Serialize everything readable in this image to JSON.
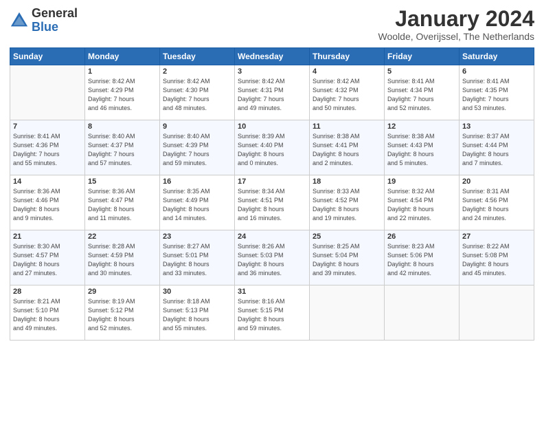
{
  "header": {
    "logo_general": "General",
    "logo_blue": "Blue",
    "month_title": "January 2024",
    "location": "Woolde, Overijssel, The Netherlands"
  },
  "days_of_week": [
    "Sunday",
    "Monday",
    "Tuesday",
    "Wednesday",
    "Thursday",
    "Friday",
    "Saturday"
  ],
  "weeks": [
    [
      {
        "day": "",
        "info": ""
      },
      {
        "day": "1",
        "info": "Sunrise: 8:42 AM\nSunset: 4:29 PM\nDaylight: 7 hours\nand 46 minutes."
      },
      {
        "day": "2",
        "info": "Sunrise: 8:42 AM\nSunset: 4:30 PM\nDaylight: 7 hours\nand 48 minutes."
      },
      {
        "day": "3",
        "info": "Sunrise: 8:42 AM\nSunset: 4:31 PM\nDaylight: 7 hours\nand 49 minutes."
      },
      {
        "day": "4",
        "info": "Sunrise: 8:42 AM\nSunset: 4:32 PM\nDaylight: 7 hours\nand 50 minutes."
      },
      {
        "day": "5",
        "info": "Sunrise: 8:41 AM\nSunset: 4:34 PM\nDaylight: 7 hours\nand 52 minutes."
      },
      {
        "day": "6",
        "info": "Sunrise: 8:41 AM\nSunset: 4:35 PM\nDaylight: 7 hours\nand 53 minutes."
      }
    ],
    [
      {
        "day": "7",
        "info": "Sunrise: 8:41 AM\nSunset: 4:36 PM\nDaylight: 7 hours\nand 55 minutes."
      },
      {
        "day": "8",
        "info": "Sunrise: 8:40 AM\nSunset: 4:37 PM\nDaylight: 7 hours\nand 57 minutes."
      },
      {
        "day": "9",
        "info": "Sunrise: 8:40 AM\nSunset: 4:39 PM\nDaylight: 7 hours\nand 59 minutes."
      },
      {
        "day": "10",
        "info": "Sunrise: 8:39 AM\nSunset: 4:40 PM\nDaylight: 8 hours\nand 0 minutes."
      },
      {
        "day": "11",
        "info": "Sunrise: 8:38 AM\nSunset: 4:41 PM\nDaylight: 8 hours\nand 2 minutes."
      },
      {
        "day": "12",
        "info": "Sunrise: 8:38 AM\nSunset: 4:43 PM\nDaylight: 8 hours\nand 5 minutes."
      },
      {
        "day": "13",
        "info": "Sunrise: 8:37 AM\nSunset: 4:44 PM\nDaylight: 8 hours\nand 7 minutes."
      }
    ],
    [
      {
        "day": "14",
        "info": "Sunrise: 8:36 AM\nSunset: 4:46 PM\nDaylight: 8 hours\nand 9 minutes."
      },
      {
        "day": "15",
        "info": "Sunrise: 8:36 AM\nSunset: 4:47 PM\nDaylight: 8 hours\nand 11 minutes."
      },
      {
        "day": "16",
        "info": "Sunrise: 8:35 AM\nSunset: 4:49 PM\nDaylight: 8 hours\nand 14 minutes."
      },
      {
        "day": "17",
        "info": "Sunrise: 8:34 AM\nSunset: 4:51 PM\nDaylight: 8 hours\nand 16 minutes."
      },
      {
        "day": "18",
        "info": "Sunrise: 8:33 AM\nSunset: 4:52 PM\nDaylight: 8 hours\nand 19 minutes."
      },
      {
        "day": "19",
        "info": "Sunrise: 8:32 AM\nSunset: 4:54 PM\nDaylight: 8 hours\nand 22 minutes."
      },
      {
        "day": "20",
        "info": "Sunrise: 8:31 AM\nSunset: 4:56 PM\nDaylight: 8 hours\nand 24 minutes."
      }
    ],
    [
      {
        "day": "21",
        "info": "Sunrise: 8:30 AM\nSunset: 4:57 PM\nDaylight: 8 hours\nand 27 minutes."
      },
      {
        "day": "22",
        "info": "Sunrise: 8:28 AM\nSunset: 4:59 PM\nDaylight: 8 hours\nand 30 minutes."
      },
      {
        "day": "23",
        "info": "Sunrise: 8:27 AM\nSunset: 5:01 PM\nDaylight: 8 hours\nand 33 minutes."
      },
      {
        "day": "24",
        "info": "Sunrise: 8:26 AM\nSunset: 5:03 PM\nDaylight: 8 hours\nand 36 minutes."
      },
      {
        "day": "25",
        "info": "Sunrise: 8:25 AM\nSunset: 5:04 PM\nDaylight: 8 hours\nand 39 minutes."
      },
      {
        "day": "26",
        "info": "Sunrise: 8:23 AM\nSunset: 5:06 PM\nDaylight: 8 hours\nand 42 minutes."
      },
      {
        "day": "27",
        "info": "Sunrise: 8:22 AM\nSunset: 5:08 PM\nDaylight: 8 hours\nand 45 minutes."
      }
    ],
    [
      {
        "day": "28",
        "info": "Sunrise: 8:21 AM\nSunset: 5:10 PM\nDaylight: 8 hours\nand 49 minutes."
      },
      {
        "day": "29",
        "info": "Sunrise: 8:19 AM\nSunset: 5:12 PM\nDaylight: 8 hours\nand 52 minutes."
      },
      {
        "day": "30",
        "info": "Sunrise: 8:18 AM\nSunset: 5:13 PM\nDaylight: 8 hours\nand 55 minutes."
      },
      {
        "day": "31",
        "info": "Sunrise: 8:16 AM\nSunset: 5:15 PM\nDaylight: 8 hours\nand 59 minutes."
      },
      {
        "day": "",
        "info": ""
      },
      {
        "day": "",
        "info": ""
      },
      {
        "day": "",
        "info": ""
      }
    ]
  ]
}
